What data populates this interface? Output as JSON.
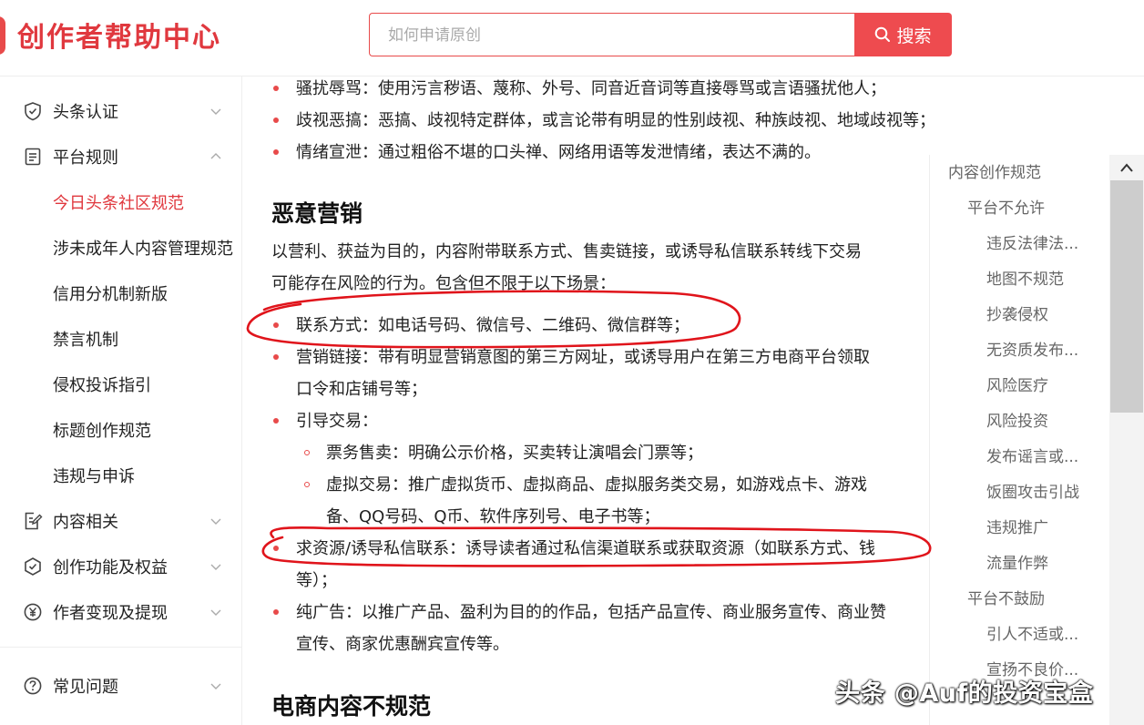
{
  "header": {
    "logo": "创作者帮助中心",
    "search_placeholder": "如何申请原创",
    "search_button": "搜索"
  },
  "sidebar": {
    "items": [
      {
        "label": "头条认证",
        "icon": "shield-check-icon",
        "expanded": false
      },
      {
        "label": "平台规则",
        "icon": "document-list-icon",
        "expanded": true
      },
      {
        "label": "内容相关",
        "icon": "edit-document-icon",
        "expanded": false
      },
      {
        "label": "创作功能及权益",
        "icon": "hexagon-check-icon",
        "expanded": false
      },
      {
        "label": "作者变现及提现",
        "icon": "yen-coin-icon",
        "expanded": false
      },
      {
        "label": "常见问题",
        "icon": "question-circle-icon",
        "expanded": false
      }
    ],
    "sub_items": [
      "今日头条社区规范",
      "涉未成年人内容管理规范",
      "信用分机制新版",
      "禁言机制",
      "侵权投诉指引",
      "标题创作规范",
      "违规与申诉"
    ],
    "active_sub": "今日头条社区规范"
  },
  "content": {
    "top_list": [
      "骚扰辱骂：使用污言秽语、蔑称、外号、同音近音词等直接辱骂或言语骚扰他人；",
      "歧视恶搞：恶搞、歧视特定群体，或言论带有明显的性别歧视、种族歧视、地域歧视等；",
      "情绪宣泄：通过粗俗不堪的口头禅、网络用语等发泄情绪，表达不满的。"
    ],
    "heading1": "恶意营销",
    "para_line1": "以营利、获益为目的，内容附带联系方式、售卖链接，或诱导私信联系转线下交易",
    "para_line2": "可能存在风险的行为。包含但不限于以下场景：",
    "item_contact": "联系方式：如电话号码、微信号、二维码、微信群等；",
    "item_link_1": "营销链接：带有明显营销意图的第三方网址，或诱导用户在第三方电商平台领取",
    "item_link_2": "口令和店铺号等；",
    "item_trade": "引导交易：",
    "sub_ticket": "票务售卖：明确公示价格，买卖转让演唱会门票等；",
    "sub_virtual_1": "虚拟交易：推广虚拟货币、虚拟商品、虚拟服务类交易，如游戏点卡、游戏",
    "sub_virtual_2": "备、QQ号码、Q币、软件序列号、电子书等；",
    "item_resource_1": "求资源/诱导私信联系：诱导读者通过私信渠道联系或获取资源（如联系方式、钱",
    "item_resource_2": "等）；",
    "item_ad_1": "纯广告：以推广产品、盈利为目的的作品，包括产品宣传、商业服务宣传、商业赞",
    "item_ad_2": "宣传、商家优惠酬宾宣传等。",
    "heading2": "电商内容不规范"
  },
  "toc": {
    "items": [
      {
        "label": "内容创作规范",
        "level": 1
      },
      {
        "label": "平台不允许",
        "level": 2
      },
      {
        "label": "违反法律法...",
        "level": 3
      },
      {
        "label": "地图不规范",
        "level": 3
      },
      {
        "label": "抄袭侵权",
        "level": 3
      },
      {
        "label": "无资质发布...",
        "level": 3
      },
      {
        "label": "风险医疗",
        "level": 3
      },
      {
        "label": "风险投资",
        "level": 3
      },
      {
        "label": "发布谣言或...",
        "level": 3
      },
      {
        "label": "饭圈攻击引战",
        "level": 3
      },
      {
        "label": "违规推广",
        "level": 3
      },
      {
        "label": "流量作弊",
        "level": 3
      },
      {
        "label": "平台不鼓励",
        "level": 2
      },
      {
        "label": "引人不适或...",
        "level": 3
      },
      {
        "label": "宣扬不良价...",
        "level": 3
      }
    ]
  },
  "watermark": "头条 @Auf的投资宝盒",
  "colors": {
    "accent": "#e84a4a",
    "annotation": "#e0141b"
  }
}
